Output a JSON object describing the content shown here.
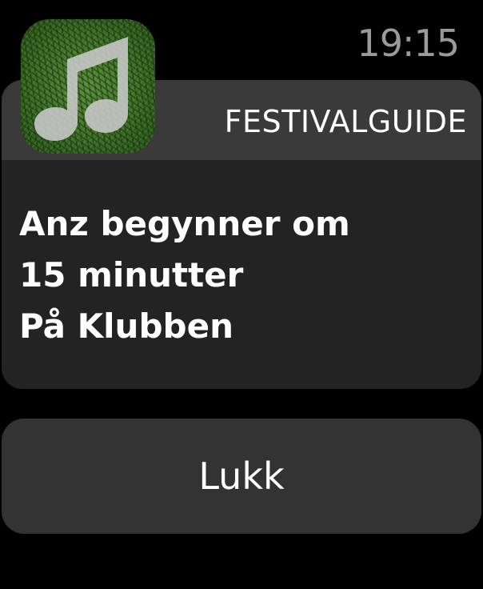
{
  "status_bar": {
    "time": "19:15"
  },
  "notification": {
    "app_icon": "music-note-icon",
    "app_name": "FESTIVALGUIDE",
    "lines": [
      "Anz begynner om",
      "15 minutter",
      "På Klubben"
    ]
  },
  "actions": {
    "close_label": "Lukk"
  },
  "colors": {
    "background": "#000000",
    "card_header": "#3a3a3a",
    "card_body": "#232323",
    "button": "#333333",
    "time_text": "#9a9a9a",
    "icon_grass": "#3f6d27",
    "icon_note": "#c9c9c9"
  }
}
